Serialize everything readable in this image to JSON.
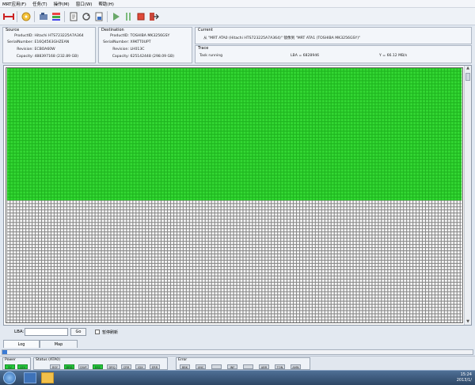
{
  "menu": [
    "MRT应用(F)",
    "任务(T)",
    "操作(M)",
    "窗口(W)",
    "帮助(H)"
  ],
  "source": {
    "title": "Source",
    "product_id_label": "ProductID:",
    "product_id": "Hitachi HTS723225A7A364",
    "serial_label": "SerialNumber:",
    "serial": "E16Q4563GHZEAN",
    "revision_label": "Revision:",
    "revision": "ECBOA60W",
    "capacity_label": "Capacity:",
    "capacity": "488397168 (232.89 GB)"
  },
  "destination": {
    "title": "Destination",
    "product_id_label": "ProductID:",
    "product_id": "TOSHIBA MK3256GSY",
    "serial_label": "SerialNumber:",
    "serial": "X9KTT0UPT",
    "revision_label": "Revision:",
    "revision": "LH013C",
    "capacity_label": "Capacity:",
    "capacity": "625142448 (298.09 GB)"
  },
  "current": {
    "title": "Current",
    "text": "从 \"MRT ATA0 (Hitachi HTS723225A7A364)\" 镜像到 \"MRT ATA1 (TOSHIBA MK3256GSY)\""
  },
  "trace": {
    "title": "Trace",
    "status": "Task running",
    "lba": "LBA = 6828946",
    "speed": "Y = 66.12 MB/s"
  },
  "map": {
    "filled_fraction": 0.515,
    "fill_color": "#22cc22"
  },
  "lba_control": {
    "label": "LBA:",
    "value": "",
    "go_label": "Go",
    "pause_label": "暂停刷新"
  },
  "tabs": [
    "Log",
    "Map"
  ],
  "status": {
    "power_title": "Power",
    "power": [
      {
        "label": "5V",
        "on": true
      },
      {
        "label": "12V",
        "on": true
      }
    ],
    "status_title": "Status (ATA0)",
    "status_flags": [
      {
        "label": "BSY",
        "on": false
      },
      {
        "label": "DRD",
        "on": true
      },
      {
        "label": "DWF",
        "on": false
      },
      {
        "label": "DSC",
        "on": true
      },
      {
        "label": "DRQ",
        "on": false
      },
      {
        "label": "CRR",
        "on": false
      },
      {
        "label": "IDX",
        "on": false
      },
      {
        "label": "ERR",
        "on": false
      }
    ],
    "error_title": "Error",
    "error_flags": [
      {
        "label": "BBK",
        "on": false
      },
      {
        "label": "UNC",
        "on": false
      },
      {
        "label": "",
        "on": false
      },
      {
        "label": "INF",
        "on": false
      },
      {
        "label": "",
        "on": false
      },
      {
        "label": "ABR",
        "on": false
      },
      {
        "label": "TON",
        "on": false
      },
      {
        "label": "AMN",
        "on": false
      }
    ]
  },
  "taskbar": {
    "time": "15:24",
    "date": "2013/1/"
  },
  "colors": {
    "map_green": "#22cc22",
    "indicator_on": "#23c93b"
  }
}
